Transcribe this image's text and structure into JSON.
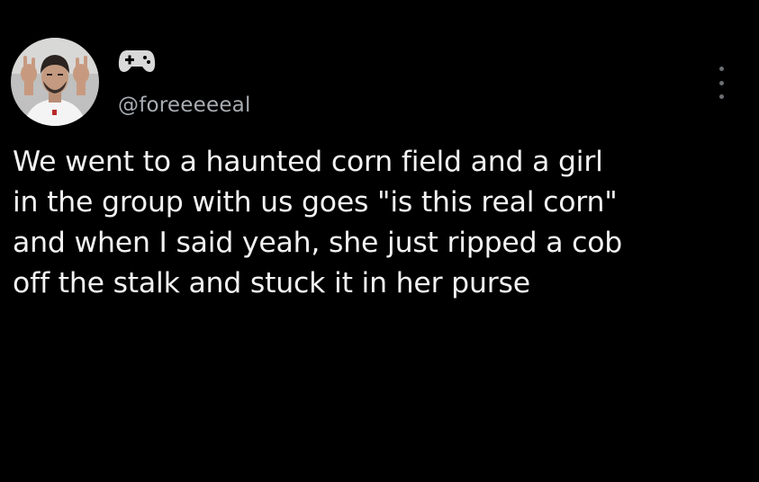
{
  "tweet": {
    "handle": "@foreeeeeal",
    "text": "We went to a haunted corn field and a girl\nin the group with us goes \"is this real corn\"\nand when I said yeah, she just ripped a cob\noff the stalk and stuck it in her purse"
  },
  "icons": {
    "avatar": "avatar",
    "badge": "gamepad-icon",
    "menu": "more-options-icon"
  },
  "colors": {
    "background": "#000000",
    "text": "#f2f2f2",
    "handle": "#a8adb2"
  }
}
